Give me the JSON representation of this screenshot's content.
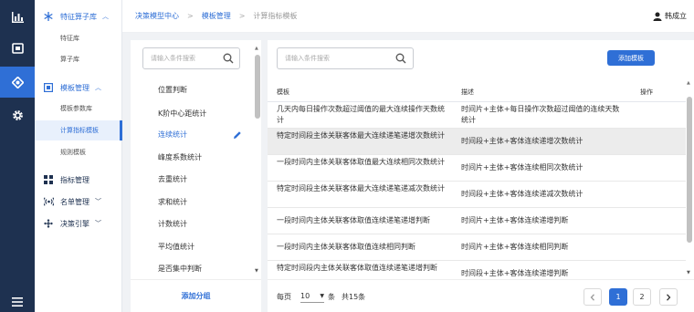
{
  "sidebar": {
    "groups": [
      {
        "label": "特征算子库"
      },
      {
        "label": "模板管理"
      },
      {
        "label": "指标管理"
      },
      {
        "label": "名单管理"
      },
      {
        "label": "决策引擎"
      }
    ],
    "sub_items": [
      {
        "label": "特征库"
      },
      {
        "label": "算子库"
      },
      {
        "label": "模板参数库"
      },
      {
        "label": "计算指标模板"
      },
      {
        "label": "规则模板"
      }
    ]
  },
  "breadcrumb": [
    "决策模型中心",
    "模板管理",
    "计算指标模板"
  ],
  "user": {
    "name": "韩成立"
  },
  "left_panel": {
    "search_placeholder": "请输入条件搜索",
    "items": [
      "位置判断",
      "K阶中心距统计",
      "连续统计",
      "峰度系数统计",
      "去重统计",
      "求和统计",
      "计数统计",
      "平均值统计",
      "是否集中判断"
    ],
    "add_group_label": "添加分组"
  },
  "right_panel": {
    "search_placeholder": "请输入条件搜索",
    "add_button": "添加模板",
    "columns": [
      "模板",
      "描述",
      "操作"
    ],
    "rows": [
      {
        "template": "几天内每日操作次数超过阈值的最大连续操作天数统计",
        "desc": "时间片+主体+每日操作次数超过阈值的连续天数统计"
      },
      {
        "template": "特定时间段主体关联客体最大连续递笔递增次数统计",
        "desc": "时间段+主体+客体连续递增次数统计"
      },
      {
        "template": "一段时间内主体关联客体取值最大连续相同次数统计",
        "desc": "时间片+主体+客体连续相同次数统计"
      },
      {
        "template": "特定时间段主体关联客体最大连续递笔递减次数统计",
        "desc": "时间段+主体+客体连续递减次数统计"
      },
      {
        "template": "一段时间内主体关联客体取值连续递笔递增判断",
        "desc": "时间片+主体+客体连续递增判断"
      },
      {
        "template": "一段时间内主体关联客体取值连续相同判断",
        "desc": "时间片+主体+客体连续相同判断"
      },
      {
        "template": "特定时间段内主体关联客体取值连续递笔递增判断",
        "desc": "时间段+主体+客体连续递增判断"
      }
    ],
    "pagination": {
      "per_page_label": "每页",
      "page_size": "10",
      "unit": "条",
      "total": "共15条",
      "pages": [
        "1",
        "2"
      ]
    }
  }
}
